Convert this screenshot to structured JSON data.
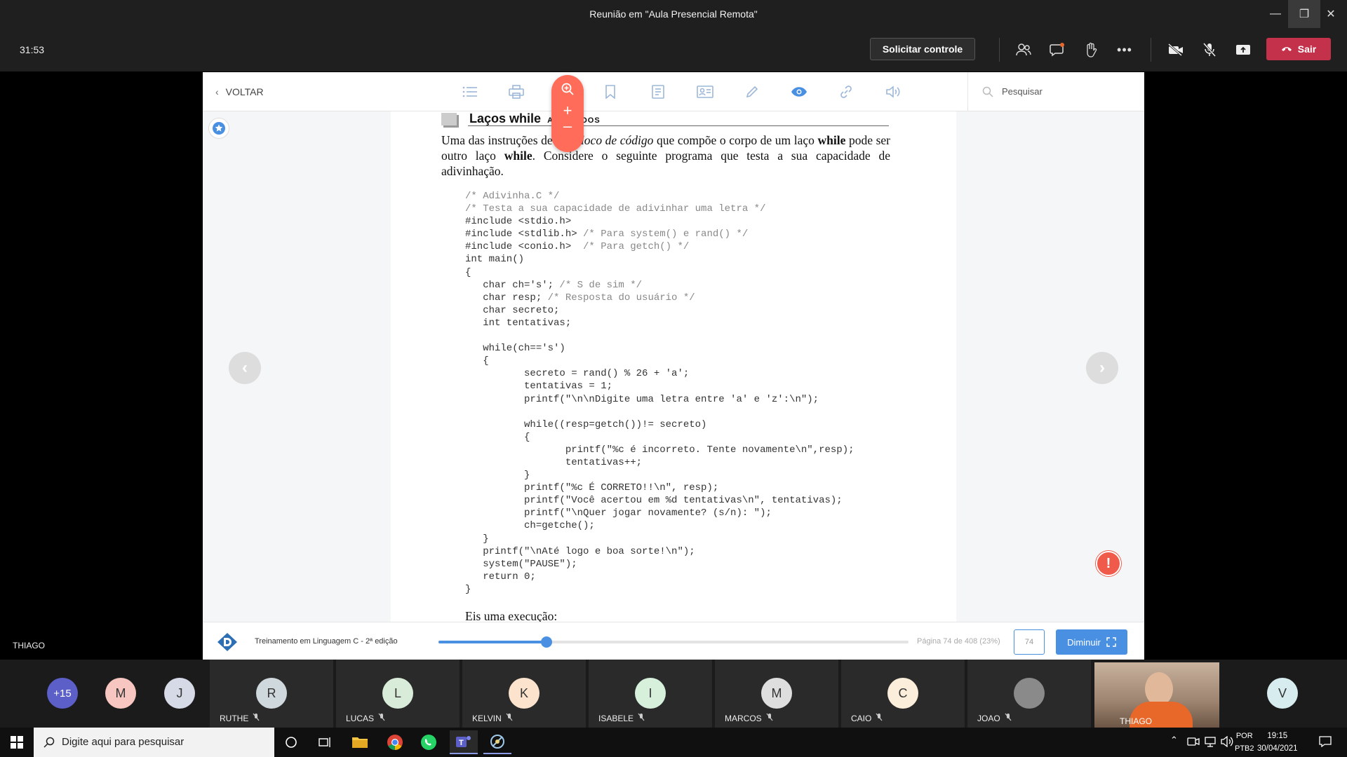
{
  "window": {
    "title": "Reunião em \"Aula Presencial Remota\""
  },
  "meeting": {
    "timer": "31:53",
    "request_control": "Solicitar controle",
    "leave": "Sair",
    "presenter": "THIAGO"
  },
  "reader": {
    "back": "VOLTAR",
    "search_placeholder": "Pesquisar",
    "heading": "Laços while aninhados",
    "heading_visible": "Laços while",
    "heading_small": "ANINHADOS",
    "paragraph_html": "Uma das instruções de um <i>bloco de código</i> que compõe o corpo de um laço <b>while</b> pode ser outro laço <b>while</b>. Considere o seguinte programa que testa a sua capacidade de adivinhação.",
    "code_lines": [
      [
        "",
        "/* Adivinha.C */"
      ],
      [
        "",
        "/* Testa a sua capacidade de adivinhar uma letra */"
      ],
      [
        "#include <stdio.h>",
        ""
      ],
      [
        "#include <stdlib.h> ",
        "/* Para system() e rand() */"
      ],
      [
        "#include <conio.h>  ",
        "/* Para getch() */"
      ],
      [
        "int main()",
        ""
      ],
      [
        "{",
        ""
      ],
      [
        "   char ch='s'; ",
        "/* S de sim */"
      ],
      [
        "   char resp; ",
        "/* Resposta do usuário */"
      ],
      [
        "   char secreto;",
        ""
      ],
      [
        "   int tentativas;",
        ""
      ],
      [
        "",
        ""
      ],
      [
        "   while(ch=='s')",
        ""
      ],
      [
        "   {",
        ""
      ],
      [
        "          secreto = rand() % 26 + 'a';",
        ""
      ],
      [
        "          tentativas = 1;",
        ""
      ],
      [
        "          printf(\"\\n\\nDigite uma letra entre 'a' e 'z':\\n\");",
        ""
      ],
      [
        "",
        ""
      ],
      [
        "          while((resp=getch())!= secreto)",
        ""
      ],
      [
        "          {",
        ""
      ],
      [
        "                 printf(\"%c é incorreto. Tente novamente\\n\",resp);",
        ""
      ],
      [
        "                 tentativas++;",
        ""
      ],
      [
        "          }",
        ""
      ],
      [
        "          printf(\"%c É CORRETO!!\\n\", resp);",
        ""
      ],
      [
        "          printf(\"Você acertou em %d tentativas\\n\", tentativas);",
        ""
      ],
      [
        "          printf(\"\\nQuer jogar novamente? (s/n): \");",
        ""
      ],
      [
        "          ch=getche();",
        ""
      ],
      [
        "   }",
        ""
      ],
      [
        "   printf(\"\\nAté logo e boa sorte!\\n\");",
        ""
      ],
      [
        "   system(\"PAUSE\");",
        ""
      ],
      [
        "   return 0;",
        ""
      ],
      [
        "}",
        ""
      ]
    ],
    "exec_text": "Eis uma execução:",
    "book_title": "Treinamento em Linguagem C - 2ª edição",
    "progress_fraction": 0.23,
    "page_info": "Página 74 de 408 (23%)",
    "page_input": "74",
    "shrink": "Diminuir",
    "colors": {
      "accent": "#4a90e2",
      "zoom": "#ff6d5a",
      "leave": "#c4314b"
    }
  },
  "participants": {
    "overflow": "+15",
    "avatars": [
      {
        "initial": "M",
        "color": "#f7c6c0"
      },
      {
        "initial": "J",
        "color": "#d6d9e6"
      }
    ],
    "tiles": [
      {
        "name": "RUTHE",
        "initial": "R",
        "color": "#cfd8dc"
      },
      {
        "name": "LUCAS",
        "initial": "L",
        "color": "#d9ecd9"
      },
      {
        "name": "KELVIN",
        "initial": "K",
        "color": "#fbe3cd"
      },
      {
        "name": "ISABELE",
        "initial": "I",
        "color": "#d6f0dc"
      },
      {
        "name": "MARCOS",
        "initial": "M",
        "color": "#dedede"
      },
      {
        "name": "CAIO",
        "initial": "C",
        "color": "#fbeeda"
      },
      {
        "name": "JOAO",
        "initial": "",
        "color": "#8a8a8a"
      }
    ],
    "video_name": "THIAGO",
    "last": {
      "initial": "V",
      "color": "#d7ecef"
    }
  },
  "taskbar": {
    "search": "Digite aqui para pesquisar",
    "lang_1": "POR",
    "lang_2": "PTB2",
    "time": "19:15",
    "date": "30/04/2021"
  }
}
